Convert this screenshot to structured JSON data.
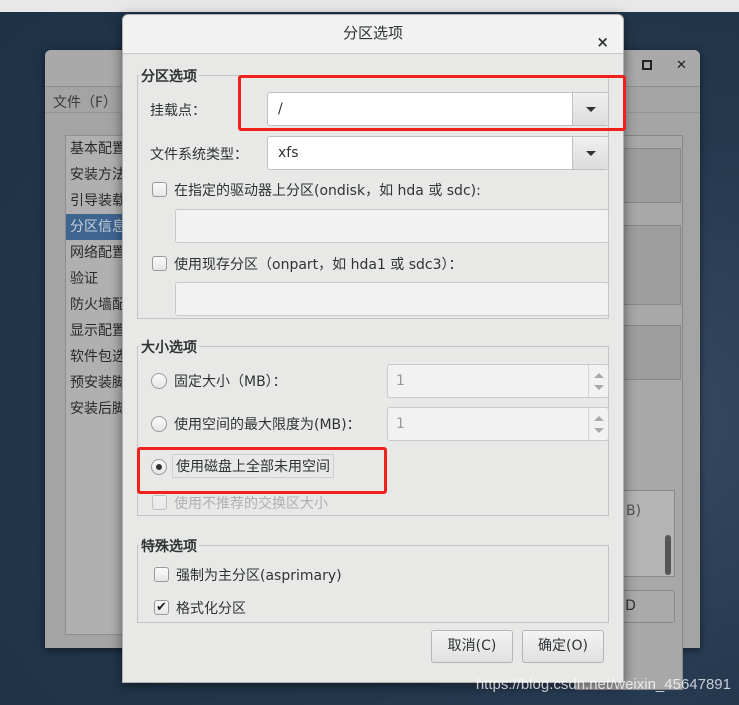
{
  "background_window": {
    "menu": {
      "file": "文件（F）"
    },
    "maximize_icon": "maximize-icon",
    "close_icon": "close-icon",
    "sidebar_items": [
      {
        "label": "基本配置",
        "selected": false
      },
      {
        "label": "安装方法",
        "selected": false
      },
      {
        "label": "引导装载",
        "selected": false
      },
      {
        "label": "分区信息",
        "selected": true
      },
      {
        "label": "网络配置",
        "selected": false
      },
      {
        "label": "验证",
        "selected": false
      },
      {
        "label": "防火墙配",
        "selected": false
      },
      {
        "label": "显示配置",
        "selected": false
      },
      {
        "label": "软件包选",
        "selected": false
      },
      {
        "label": "预安装脚",
        "selected": false
      },
      {
        "label": "安装后脚",
        "selected": false
      }
    ],
    "partial_text_1": "B)",
    "partial_button": "ID"
  },
  "dialog": {
    "title": "分区选项",
    "close": "×",
    "partition_options": {
      "legend": "分区选项",
      "mount_point_label": "挂载点：",
      "mount_point_value": "/",
      "fs_type_label": "文件系统类型：",
      "fs_type_value": "xfs",
      "ondisk_label": "在指定的驱动器上分区(ondisk，如 hda 或 sdc):",
      "ondisk_checked": false,
      "ondisk_value": "",
      "onpart_label": "使用现存分区（onpart，如 hda1 或 sdc3）：",
      "onpart_checked": false,
      "onpart_value": ""
    },
    "size_options": {
      "legend": "大小选项",
      "fixed_label": "固定大小（MB）：",
      "fixed_value": "1",
      "max_label": "使用空间的最大限度为(MB)：",
      "max_value": "1",
      "fill_label": "使用磁盘上全部未用空间",
      "selected": "fill",
      "swap_label": "使用不推荐的交换区大小",
      "swap_checked": false,
      "swap_enabled": false
    },
    "special_options": {
      "legend": "特殊选项",
      "asprimary_label": "强制为主分区(asprimary)",
      "asprimary_checked": false,
      "format_label": "格式化分区",
      "format_checked": true
    },
    "cancel": "取消(C)",
    "ok": "确定(O)"
  },
  "highlight_color": "#f0201c",
  "watermark": "https://blog.csdn.net/weixin_45647891"
}
